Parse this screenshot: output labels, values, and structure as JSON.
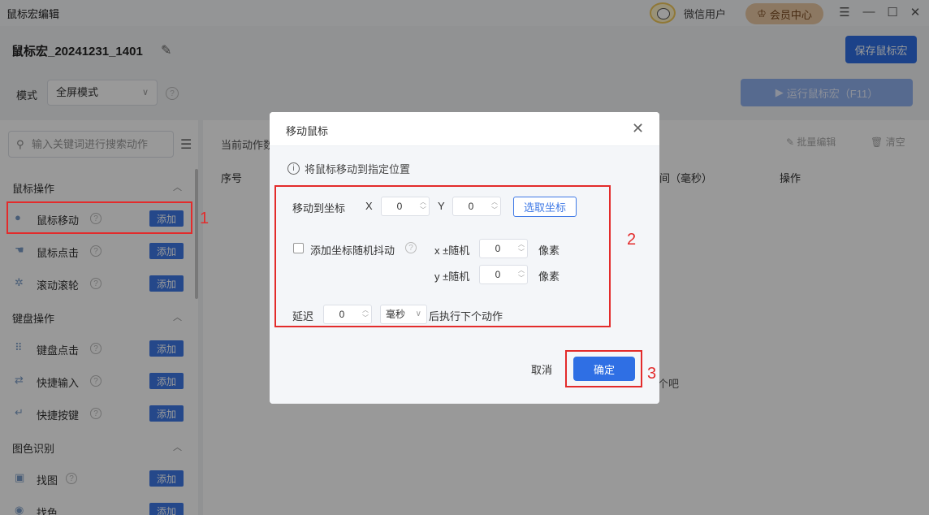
{
  "window": {
    "title": "鼠标宏编辑",
    "user_name": "微信用户",
    "vip_label": "会员中心",
    "controls": [
      "menu-icon",
      "minimize-icon",
      "maximize-icon",
      "close-icon"
    ]
  },
  "header": {
    "macro_name": "鼠标宏_20241231_1401",
    "save_label": "保存鼠标宏"
  },
  "mode": {
    "label": "模式",
    "selected": "全屏模式",
    "run_label": "运行鼠标宏（F11）"
  },
  "sidebar": {
    "search_placeholder": "输入关键词进行搜索动作",
    "groups": [
      {
        "title": "鼠标操作",
        "items": [
          {
            "label": "鼠标移动",
            "icon": "mouse-icon",
            "add": "添加"
          },
          {
            "label": "鼠标点击",
            "icon": "mouse-click-icon",
            "add": "添加"
          },
          {
            "label": "滚动滚轮",
            "icon": "scroll-wheel-icon",
            "add": "添加"
          }
        ]
      },
      {
        "title": "键盘操作",
        "items": [
          {
            "label": "键盘点击",
            "icon": "keyboard-icon",
            "add": "添加"
          },
          {
            "label": "快捷输入",
            "icon": "quick-input-icon",
            "add": "添加"
          },
          {
            "label": "快捷按键",
            "icon": "shortcut-key-icon",
            "add": "添加"
          }
        ]
      },
      {
        "title": "图色识别",
        "items": [
          {
            "label": "找图",
            "icon": "image-search-icon",
            "add": "添加"
          },
          {
            "label": "找色",
            "icon": "color-search-icon",
            "add": "添加"
          }
        ]
      }
    ]
  },
  "main": {
    "current_actions": "当前动作数",
    "batch_edit": "批量编辑",
    "clear": "清空",
    "columns": [
      "序号",
      "间（毫秒）",
      "操作"
    ],
    "empty_hint": "个吧"
  },
  "dialog": {
    "title": "移动鼠标",
    "info": "将鼠标移动到指定位置",
    "move_to_label": "移动到坐标",
    "x_label": "X",
    "x_value": "0",
    "y_label": "Y",
    "y_value": "0",
    "pick_button": "选取坐标",
    "jitter_label": "添加坐标随机抖动",
    "jitter_checked": false,
    "x_rand_label": "x ±随机",
    "x_rand_value": "0",
    "y_rand_label": "y ±随机",
    "y_rand_value": "0",
    "pixel_unit": "像素",
    "delay_label": "延迟",
    "delay_value": "0",
    "delay_unit": "毫秒",
    "delay_suffix": "后执行下个动作",
    "cancel": "取消",
    "confirm": "确定"
  },
  "annotations": [
    "1",
    "2",
    "3"
  ],
  "colors": {
    "primary": "#2f6fe4",
    "annotation_red": "#e32b2b",
    "vip_bg": "#e9c9a3"
  }
}
